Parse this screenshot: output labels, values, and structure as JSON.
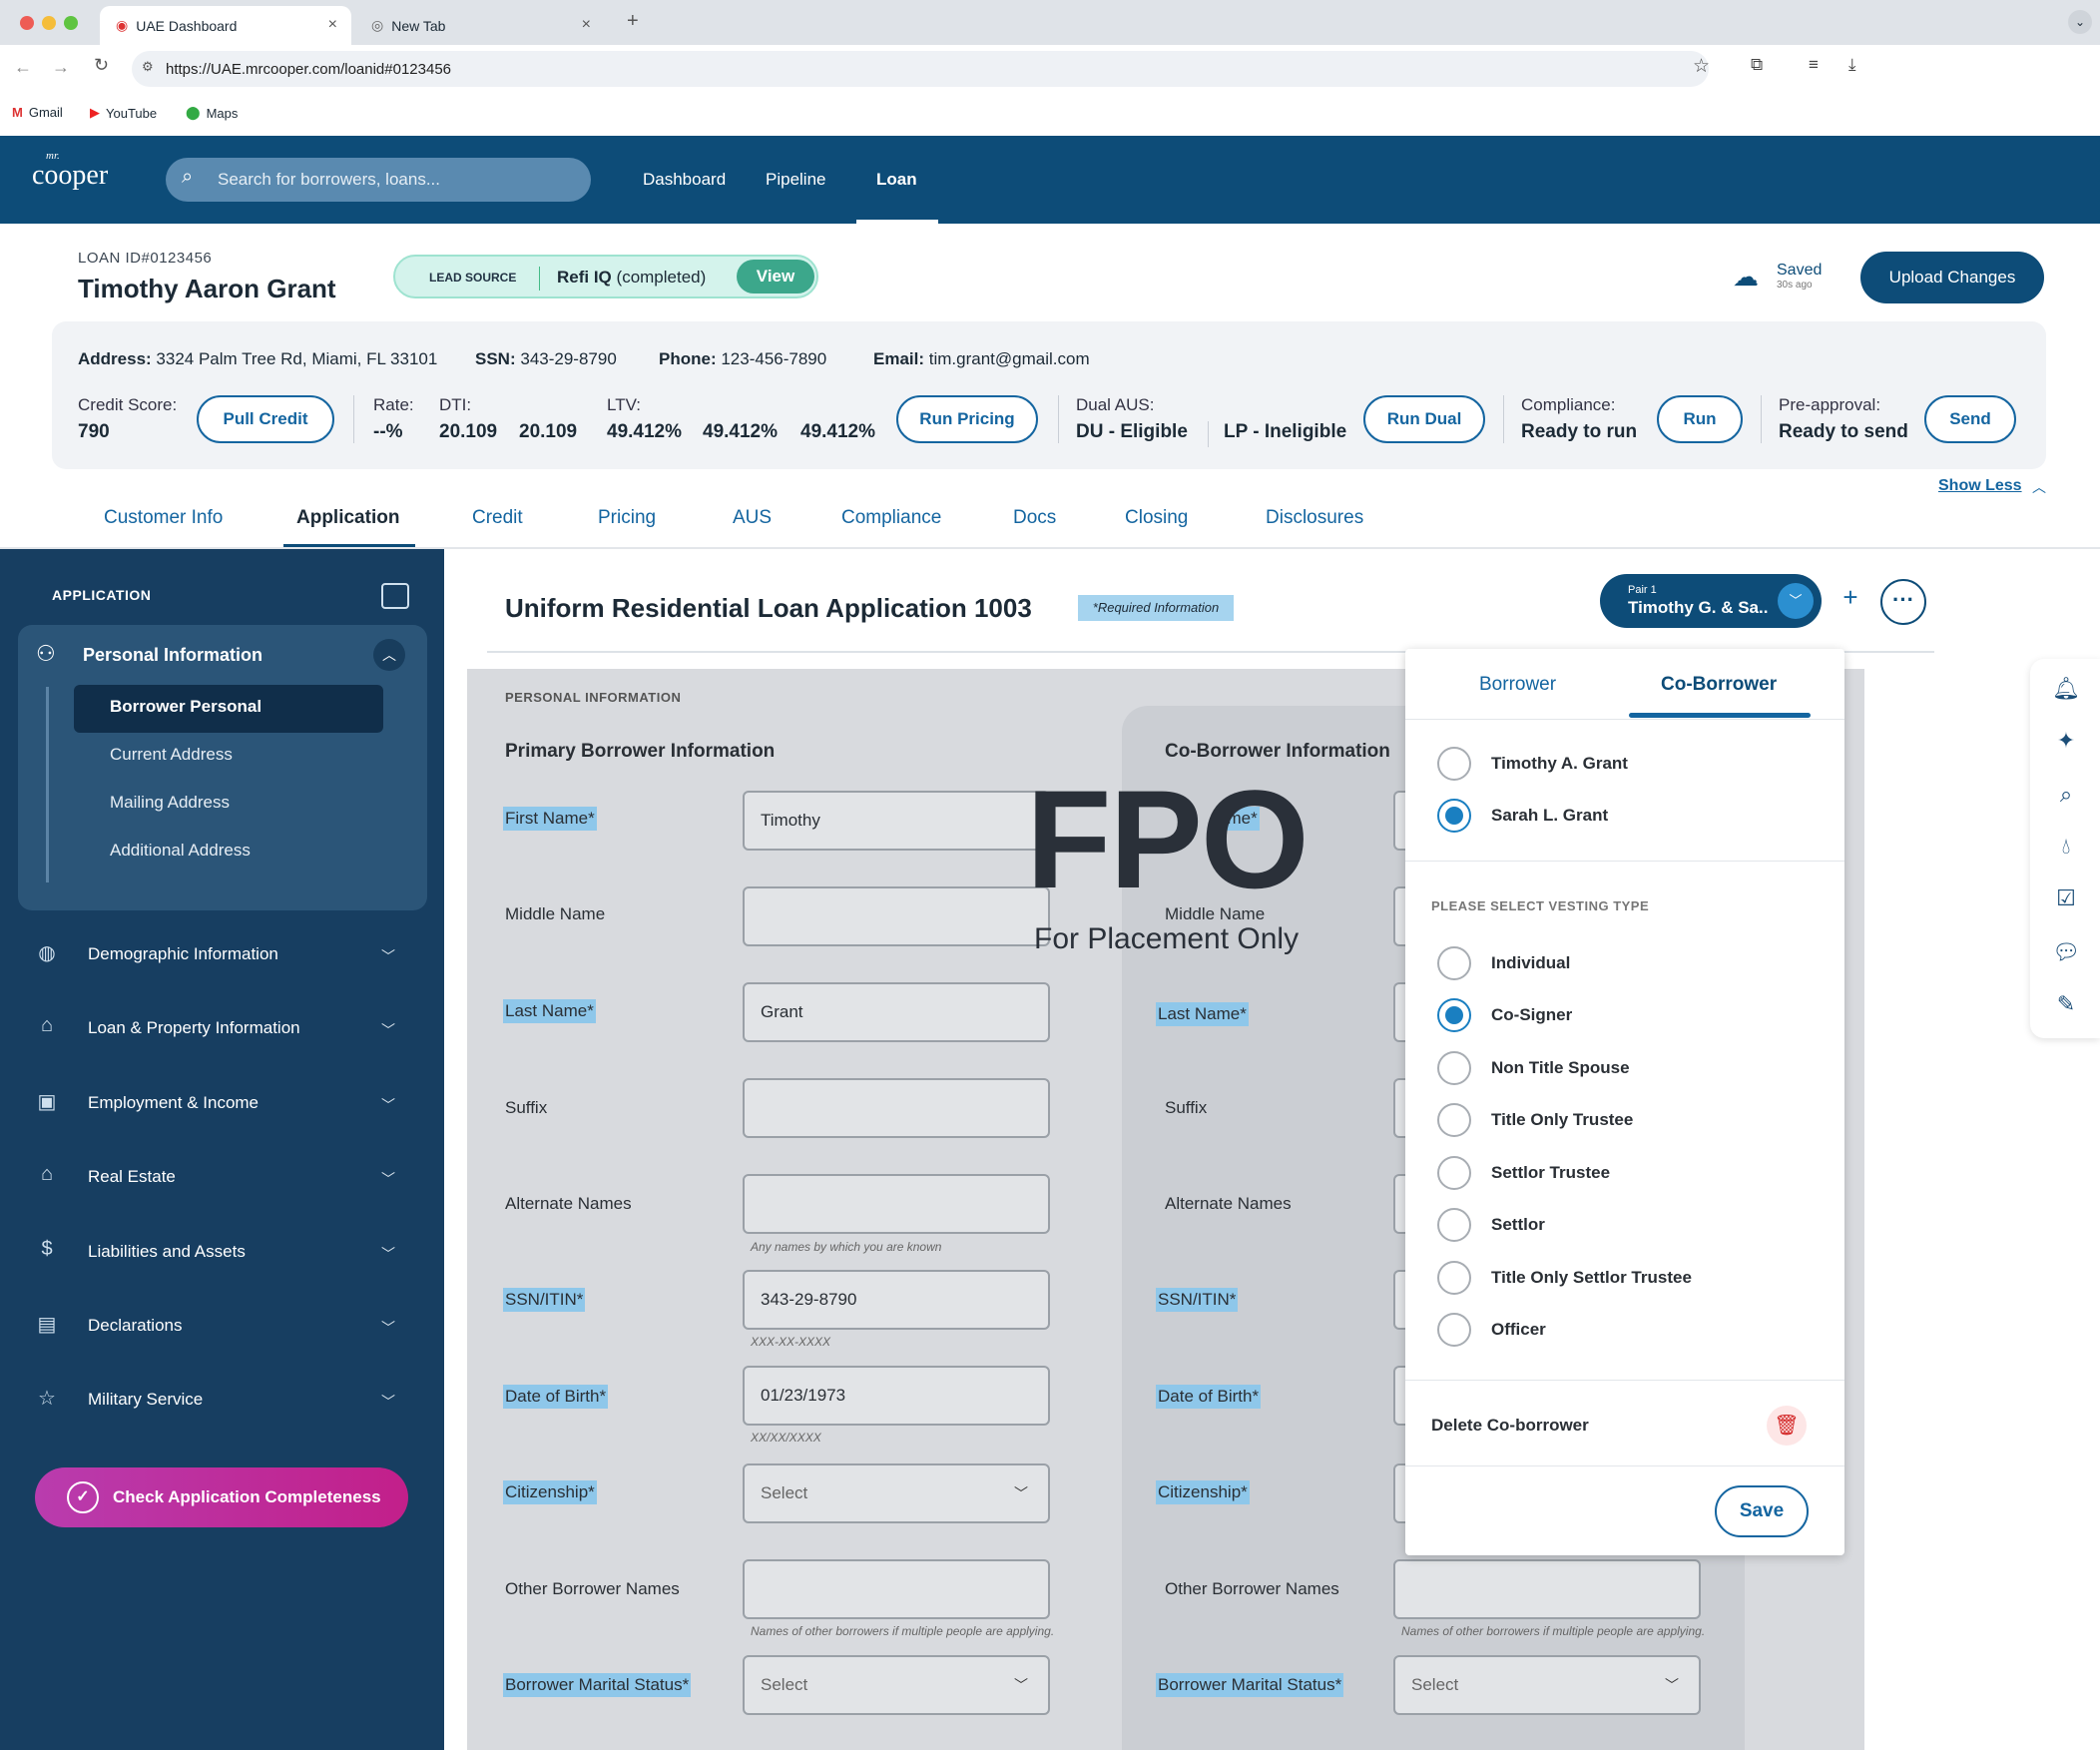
{
  "browser": {
    "tabs": [
      {
        "title": "UAE Dashboard"
      },
      {
        "title": "New Tab"
      }
    ],
    "url": "https://UAE.mrcooper.com/loanid#0123456",
    "bookmarks": [
      "Gmail",
      "YouTube",
      "Maps"
    ]
  },
  "app": {
    "logo_small": "mr.",
    "logo": "cooper",
    "search_placeholder": "Search for borrowers, loans...",
    "nav": [
      "Dashboard",
      "Pipeline",
      "Loan"
    ]
  },
  "loan": {
    "id": "LOAN ID#0123456",
    "borrower": "Timothy Aaron Grant",
    "lead_source_label": "LEAD SOURCE",
    "lead_source_value": "Refi IQ",
    "lead_source_status": "(completed)",
    "view_label": "View",
    "saved": "Saved",
    "saved_ago": "30s ago",
    "upload_label": "Upload Changes"
  },
  "summary": {
    "address_label": "Address:",
    "address": "3324 Palm Tree Rd, Miami, FL 33101",
    "ssn_label": "SSN:",
    "ssn": "343-29-8790",
    "phone_label": "Phone:",
    "phone": "123-456-7890",
    "email_label": "Email:",
    "email": "tim.grant@gmail.com",
    "credit_label": "Credit Score:",
    "credit": "790",
    "pull_credit": "Pull Credit",
    "rate_label": "Rate:",
    "rate": "--%",
    "dti_label": "DTI:",
    "dti1": "20.109",
    "dti2": "20.109",
    "ltv_label": "LTV:",
    "ltv1": "49.412%",
    "ltv2": "49.412%",
    "ltv3": "49.412%",
    "run_pricing": "Run Pricing",
    "aus_label": "Dual AUS:",
    "aus_du": "DU - Eligible",
    "aus_lp": "LP - Ineligible",
    "run_dual": "Run Dual",
    "compliance_label": "Compliance:",
    "compliance": "Ready to run",
    "run": "Run",
    "preapproval_label": "Pre-approval:",
    "preapproval": "Ready to send",
    "send": "Send",
    "show_less": "Show Less"
  },
  "page_tabs": [
    "Customer Info",
    "Application",
    "Credit",
    "Pricing",
    "AUS",
    "Compliance",
    "Docs",
    "Closing",
    "Disclosures"
  ],
  "sidebar": {
    "title": "APPLICATION",
    "section": "Personal Information",
    "sub": [
      "Borrower Personal",
      "Current Address",
      "Mailing Address",
      "Additional Address"
    ],
    "items": [
      "Demographic Information",
      "Loan & Property Information",
      "Employment & Income",
      "Real Estate",
      "Liabilities and Assets",
      "Declarations",
      "Military Service"
    ],
    "check_label": "Check Application Completeness"
  },
  "form": {
    "title": "Uniform Residential Loan Application 1003",
    "required": "*Required Information",
    "pair_label": "Pair 1",
    "pair_name": "Timothy G. & Sa..",
    "section": "PERSONAL INFORMATION",
    "primary_heading": "Primary Borrower Information",
    "co_heading": "Co-Borrower Information",
    "labels": {
      "first": "First Name*",
      "middle": "Middle Name",
      "last": "Last Name*",
      "suffix": "Suffix",
      "alt": "Alternate Names",
      "ssn": "SSN/ITIN*",
      "dob": "Date of Birth*",
      "citizenship": "Citizenship*",
      "other": "Other Borrower Names",
      "marital": "Borrower Marital Status*"
    },
    "co_first_partial": "ame*",
    "values": {
      "first": "Timothy",
      "last": "Grant",
      "ssn": "343-29-8790",
      "dob": "01/23/1973",
      "select": "Select"
    },
    "hints": {
      "alt": "Any names by which you are known",
      "ssn": "XXX-XX-XXXX",
      "dob": "XX/XX/XXXX",
      "other": "Names of other borrowers if multiple people are applying."
    },
    "fpo": "FPO",
    "fpo_sub": "For Placement Only"
  },
  "popup": {
    "tabs": [
      "Borrower",
      "Co-Borrower"
    ],
    "people": [
      "Timothy A. Grant",
      "Sarah L. Grant"
    ],
    "vesting_title": "PLEASE SELECT VESTING TYPE",
    "vesting": [
      "Individual",
      "Co-Signer",
      "Non Title Spouse",
      "Title Only Trustee",
      "Settlor Trustee",
      "Settlor",
      "Title Only Settlor Trustee",
      "Officer"
    ],
    "selected_person": "Sarah L. Grant",
    "selected_vesting": "Co-Signer",
    "delete_label": "Delete Co-borrower",
    "save_label": "Save"
  },
  "rail_icons": [
    "bell-icon",
    "sparkle-icon",
    "document-search-icon",
    "drop-icon",
    "checklist-icon",
    "chat-icon",
    "notes-icon"
  ]
}
